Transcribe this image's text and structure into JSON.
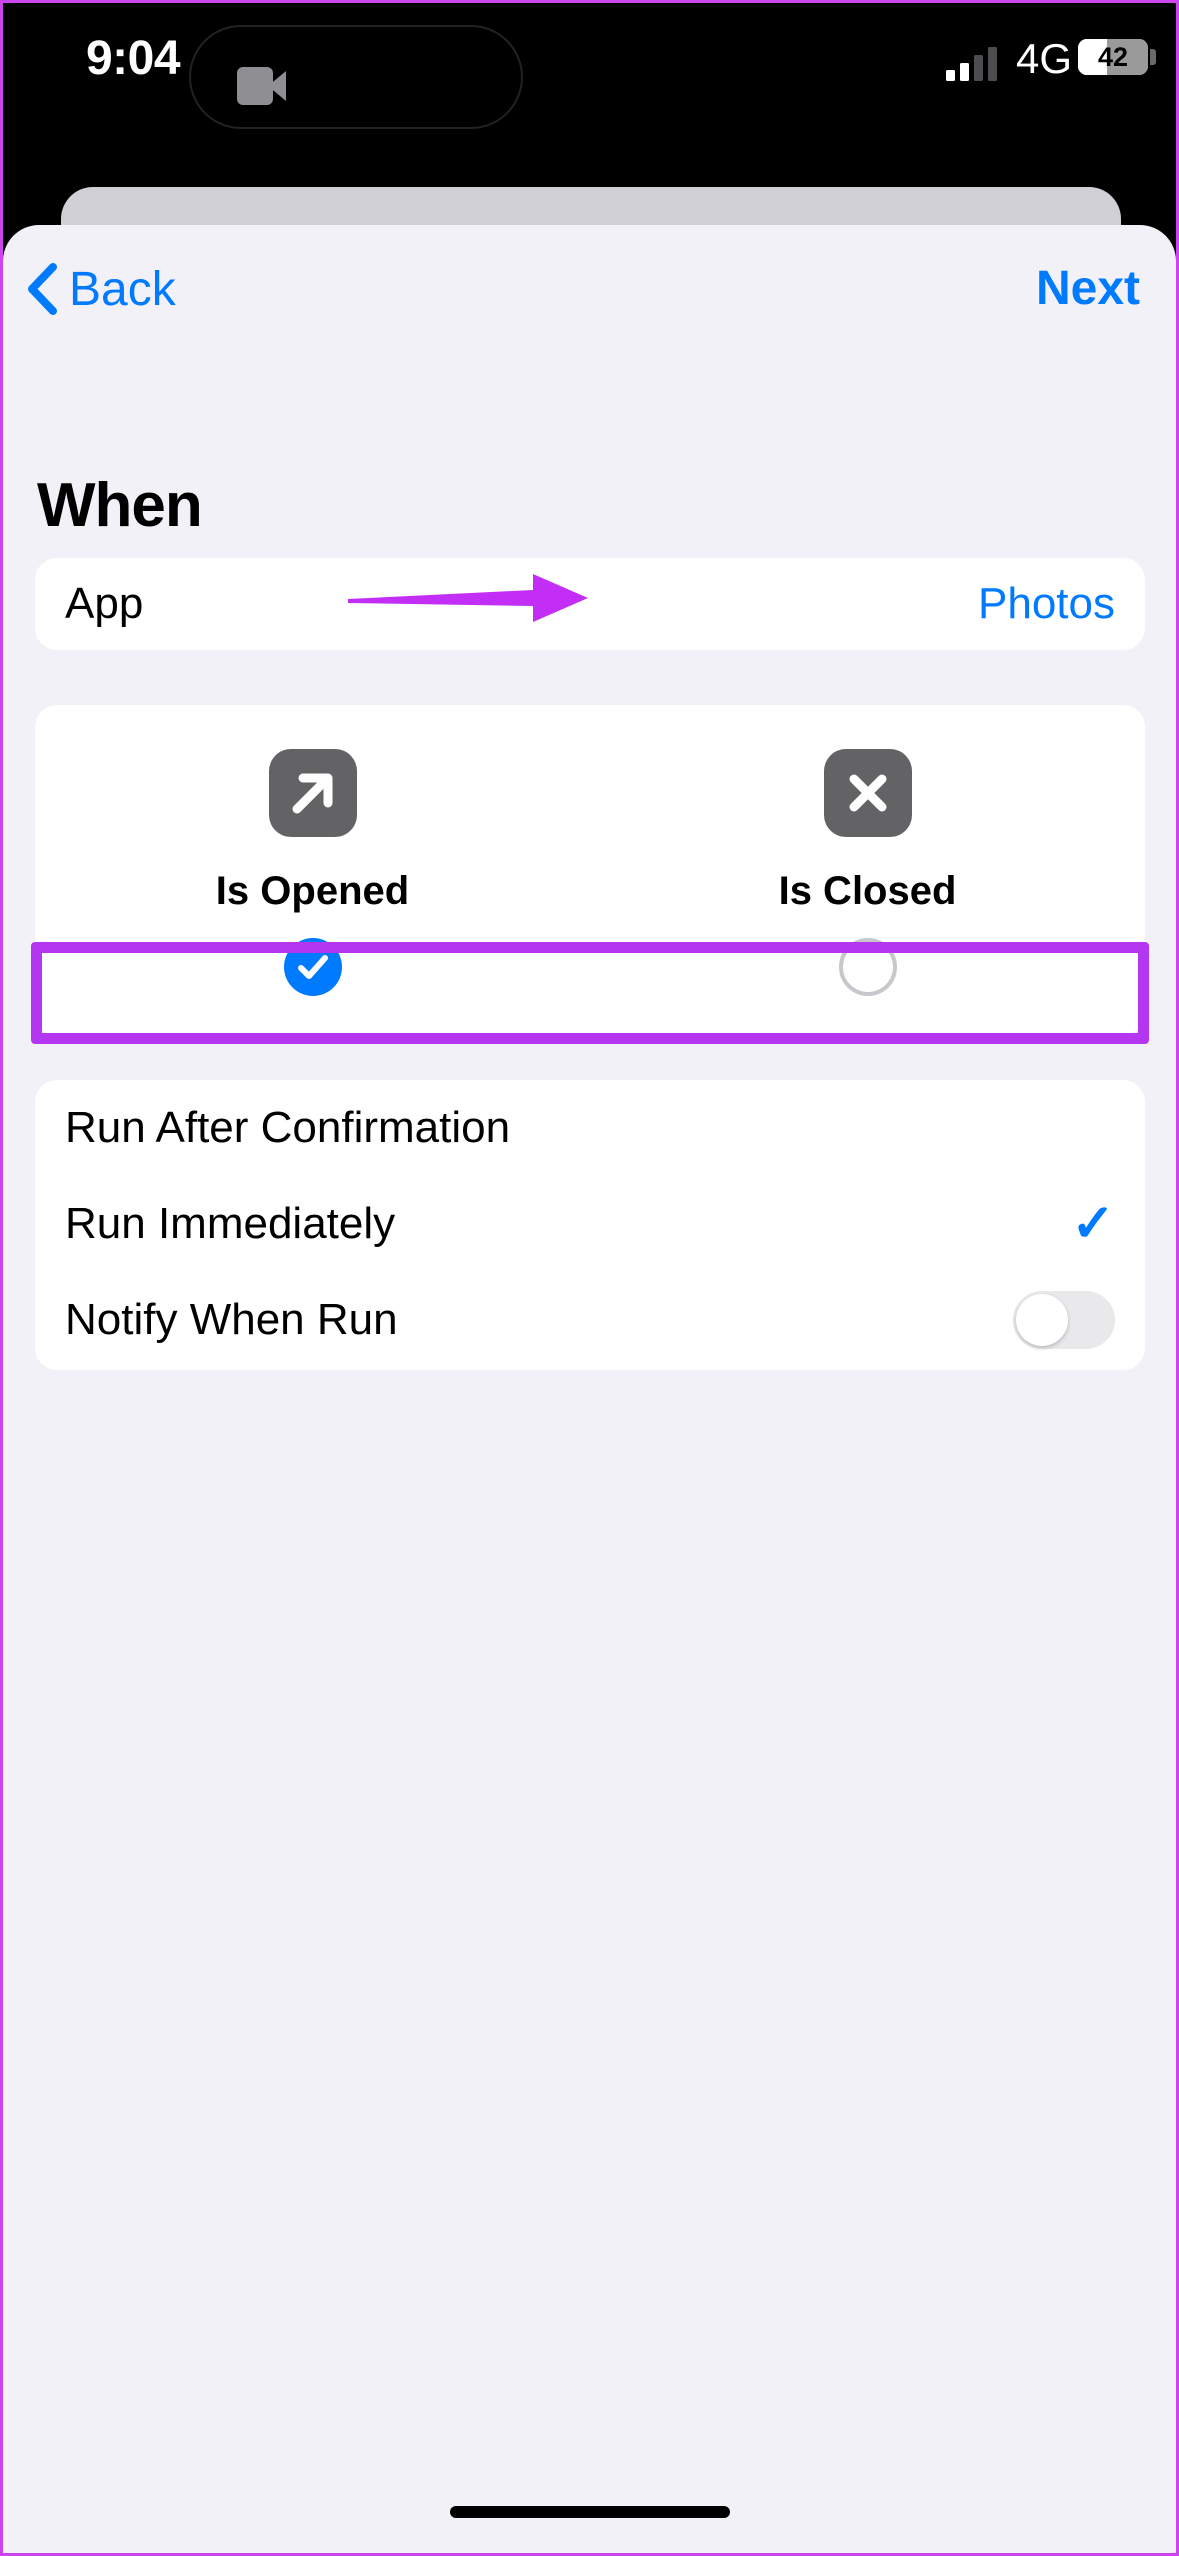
{
  "status_bar": {
    "time": "9:04",
    "network": "4G",
    "battery_level": "42",
    "icons": {
      "camera": "video-camera-icon",
      "signal": "cellular-signal-icon",
      "battery": "battery-icon"
    }
  },
  "nav": {
    "back_label": "Back",
    "next_label": "Next",
    "back_icon": "chevron-left-icon"
  },
  "page": {
    "title": "When"
  },
  "app_row": {
    "label": "App",
    "value": "Photos"
  },
  "trigger_options": [
    {
      "label": "Is Opened",
      "icon": "arrow-up-right-icon",
      "selected": true
    },
    {
      "label": "Is Closed",
      "icon": "close-x-icon",
      "selected": false
    }
  ],
  "run_options": [
    {
      "label": "Run After Confirmation",
      "checked": false,
      "type": "check"
    },
    {
      "label": "Run Immediately",
      "checked": true,
      "type": "check",
      "checkmark": "✓",
      "highlighted": true
    },
    {
      "label": "Notify When Run",
      "type": "toggle",
      "toggle_on": false
    }
  ],
  "colors": {
    "accent_blue": "#007AFF",
    "annotation_purple": "#B536F0",
    "tile_gray": "#636366",
    "sheet_background": "#F2F1F7"
  }
}
